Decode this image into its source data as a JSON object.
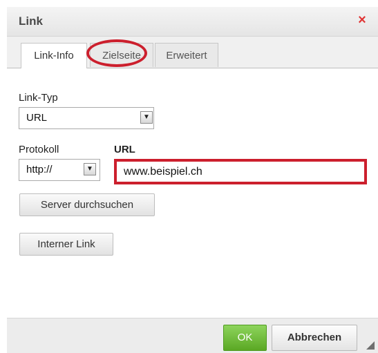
{
  "dialog": {
    "title": "Link",
    "close_icon": "×"
  },
  "tabs": [
    {
      "label": "Link-Info",
      "active": true
    },
    {
      "label": "Zielseite",
      "active": false
    },
    {
      "label": "Erweitert",
      "active": false
    }
  ],
  "form": {
    "link_type_label": "Link-Typ",
    "link_type_value": "URL",
    "protocol_label": "Protokoll",
    "protocol_value": "http://",
    "url_label": "URL",
    "url_value": "www.beispiel.ch",
    "dropdown_icon": "▼"
  },
  "buttons": {
    "browse_server": "Server durchsuchen",
    "internal_link": "Interner Link",
    "ok": "OK",
    "cancel": "Abbrechen"
  },
  "colors": {
    "highlight": "#cc1f2d",
    "ok_green": "#5ba824",
    "close_red": "#e03434"
  }
}
